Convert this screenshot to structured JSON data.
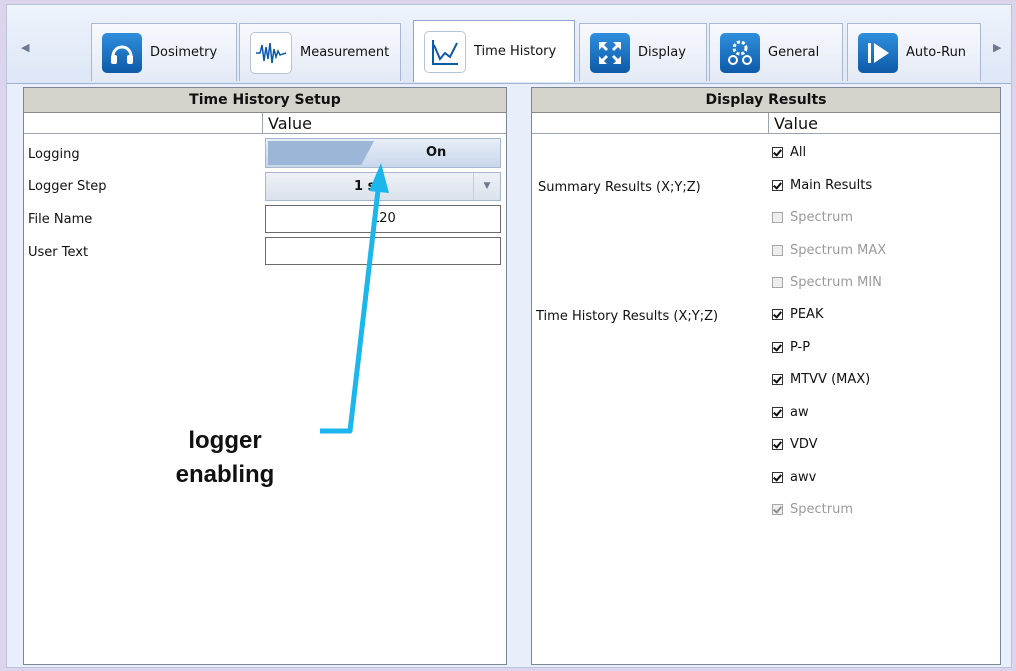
{
  "tabs": [
    {
      "label": "Dosimetry",
      "icon": "headphones-icon"
    },
    {
      "label": "Measurement",
      "icon": "waveform-icon"
    },
    {
      "label": "Time History",
      "icon": "line-chart-icon"
    },
    {
      "label": "Display",
      "icon": "expand-arrows-icon"
    },
    {
      "label": "General",
      "icon": "gears-icon"
    },
    {
      "label": "Auto-Run",
      "icon": "play-icon"
    }
  ],
  "active_tab": "Time History",
  "left_panel": {
    "title": "Time History Setup",
    "column_header": "Value",
    "rows": [
      {
        "label": "Logging",
        "value": "On"
      },
      {
        "label": "Logger Step",
        "value": "1 s"
      },
      {
        "label": "File Name",
        "value": "L20"
      },
      {
        "label": "User Text",
        "value": ""
      }
    ]
  },
  "right_panel": {
    "title": "Display Results",
    "column_header": "Value",
    "group_labels": {
      "summary": "Summary Results (X;Y;Z)",
      "time_history": "Time History Results  (X;Y;Z)"
    },
    "options": [
      {
        "label": "All",
        "checked": true,
        "enabled": true
      },
      {
        "label": "Main Results",
        "checked": true,
        "enabled": true
      },
      {
        "label": "Spectrum",
        "checked": false,
        "enabled": false
      },
      {
        "label": "Spectrum MAX",
        "checked": false,
        "enabled": false
      },
      {
        "label": "Spectrum MIN",
        "checked": false,
        "enabled": false
      },
      {
        "label": "PEAK",
        "checked": true,
        "enabled": true
      },
      {
        "label": "P-P",
        "checked": true,
        "enabled": true
      },
      {
        "label": "MTVV (MAX)",
        "checked": true,
        "enabled": true
      },
      {
        "label": "aw",
        "checked": true,
        "enabled": true
      },
      {
        "label": "VDV",
        "checked": true,
        "enabled": true
      },
      {
        "label": "awv",
        "checked": true,
        "enabled": true
      },
      {
        "label": "Spectrum",
        "checked": true,
        "enabled": false
      }
    ]
  },
  "annotation": {
    "text": "logger enabling"
  },
  "colors": {
    "annotation_arrow": "#1ab6ec",
    "toggle_fill": "#9bb6d6",
    "header_bg": "#d6d3cc"
  }
}
